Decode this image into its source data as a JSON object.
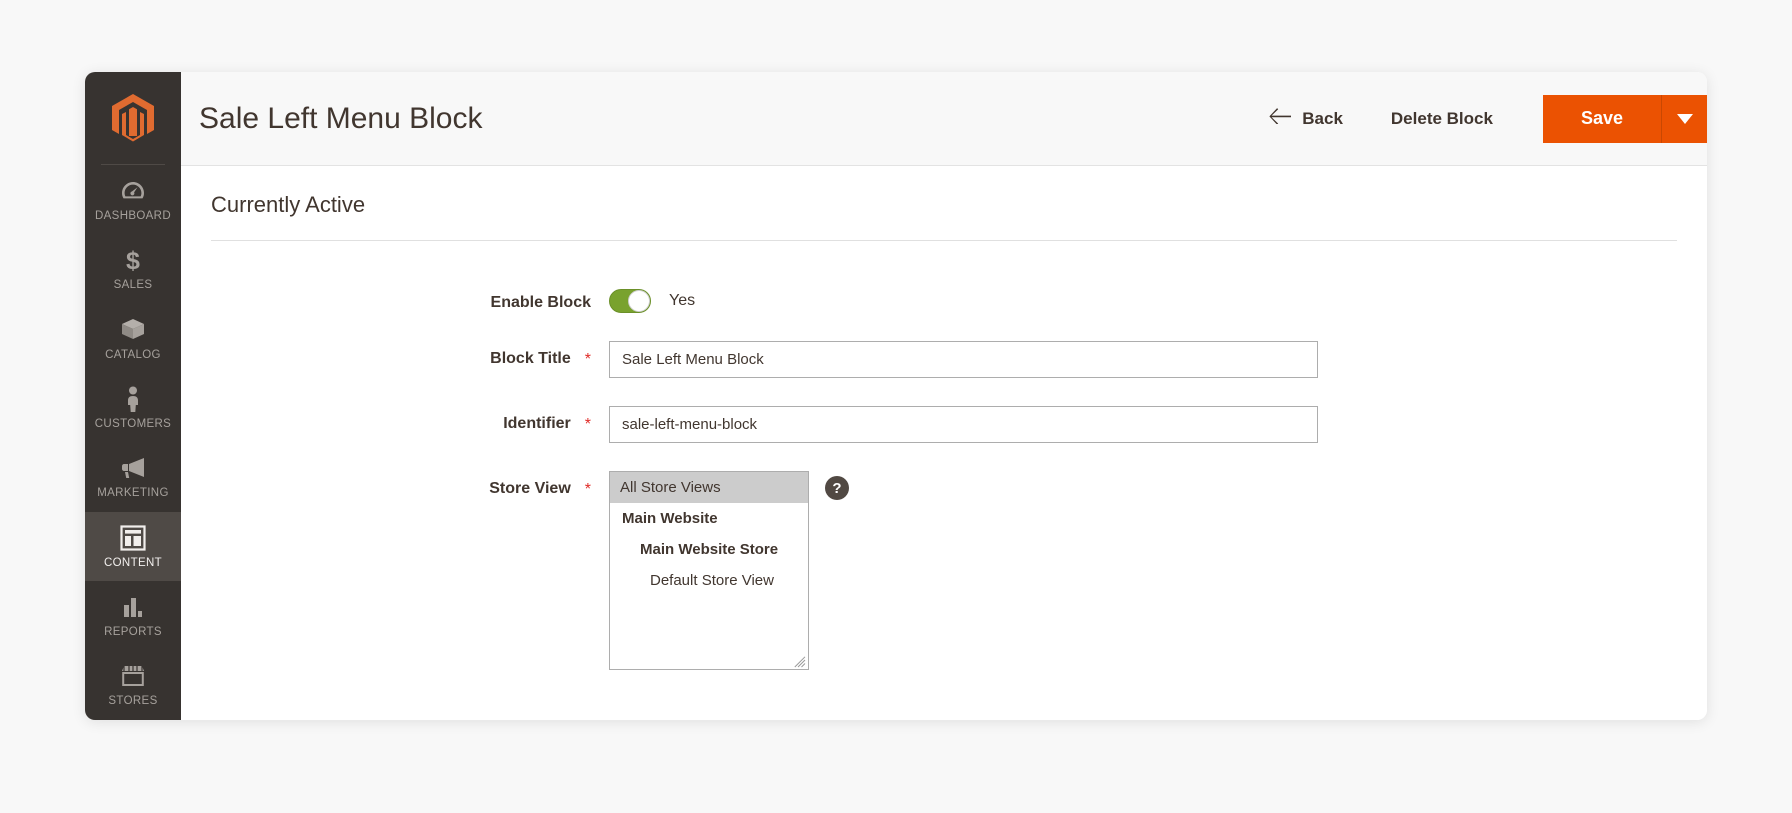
{
  "sidebar": {
    "logo": "magento-logo",
    "items": [
      {
        "label": "DASHBOARD",
        "icon": "dashboard-gauge-icon",
        "active": false
      },
      {
        "label": "SALES",
        "icon": "dollar-sign-icon",
        "active": false
      },
      {
        "label": "CATALOG",
        "icon": "box-icon",
        "active": false
      },
      {
        "label": "CUSTOMERS",
        "icon": "person-icon",
        "active": false
      },
      {
        "label": "MARKETING",
        "icon": "megaphone-icon",
        "active": false
      },
      {
        "label": "CONTENT",
        "icon": "layout-blocks-icon",
        "active": true
      },
      {
        "label": "REPORTS",
        "icon": "bar-chart-icon",
        "active": false
      },
      {
        "label": "STORES",
        "icon": "storefront-icon",
        "active": false
      }
    ]
  },
  "header": {
    "title": "Sale Left Menu Block",
    "back_label": "Back",
    "back_icon": "arrow-left-icon",
    "delete_label": "Delete Block",
    "save_label": "Save",
    "save_caret_icon": "caret-down-icon",
    "accent_color": "#eb5202"
  },
  "section": {
    "title": "Currently Active"
  },
  "form": {
    "enable_block": {
      "label": "Enable Block",
      "required": false,
      "toggle_state": "on",
      "toggle_text": "Yes",
      "toggle_color": "#79a22e"
    },
    "block_title": {
      "label": "Block Title",
      "required": true,
      "required_marker": "*",
      "value": "Sale Left Menu Block",
      "placeholder": ""
    },
    "identifier": {
      "label": "Identifier",
      "required": true,
      "required_marker": "*",
      "value": "sale-left-menu-block",
      "placeholder": ""
    },
    "store_view": {
      "label": "Store View",
      "required": true,
      "required_marker": "*",
      "help_icon": "question-mark-icon",
      "help_label": "?",
      "options": [
        {
          "label": "All Store Views",
          "level": 0,
          "selected": true
        },
        {
          "label": "Main Website",
          "level": 1,
          "selected": false
        },
        {
          "label": "Main Website Store",
          "level": 2,
          "selected": false
        },
        {
          "label": "Default Store View",
          "level": 3,
          "selected": false
        }
      ]
    }
  }
}
